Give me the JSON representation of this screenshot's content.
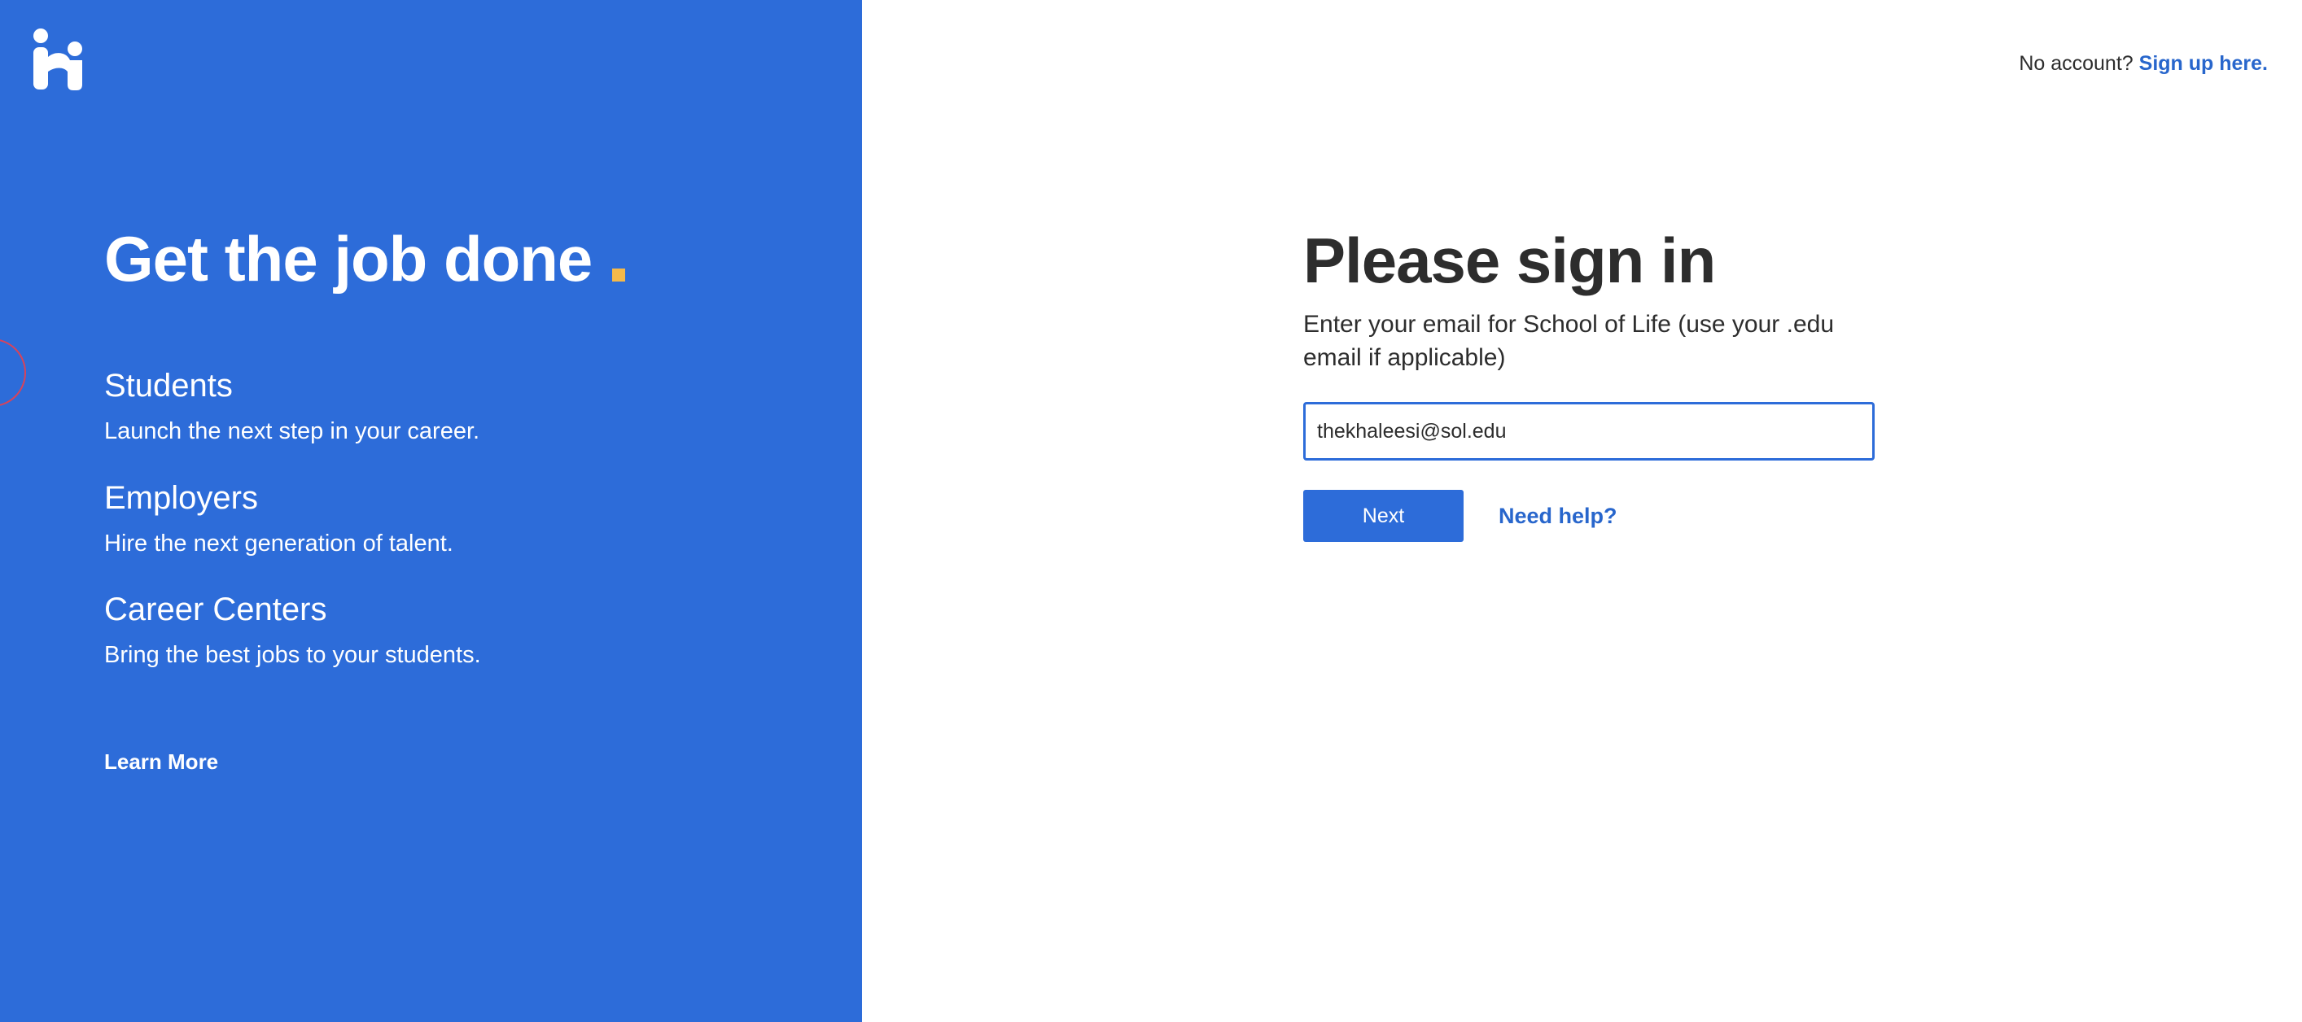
{
  "colors": {
    "brand_blue": "#2d6cd9",
    "link_blue": "#2866cc",
    "accent_yellow": "#f5b94a",
    "text_dark": "#2d2d2d"
  },
  "brand": {
    "logo_icon": "handshake-logo-icon"
  },
  "left": {
    "headline": "Get the job done",
    "audiences": [
      {
        "title": "Students",
        "description": "Launch the next step in your career."
      },
      {
        "title": "Employers",
        "description": "Hire the next generation of talent."
      },
      {
        "title": "Career Centers",
        "description": "Bring the best jobs to your students."
      }
    ],
    "learn_more": "Learn More"
  },
  "header": {
    "no_account": "No account?",
    "signup_link": "Sign up here."
  },
  "signin": {
    "title": "Please sign in",
    "subtitle": "Enter your email for School of Life (use your .edu email if applicable)",
    "email_value": "thekhaleesi@sol.edu",
    "next_label": "Next",
    "help_label": "Need help?"
  }
}
